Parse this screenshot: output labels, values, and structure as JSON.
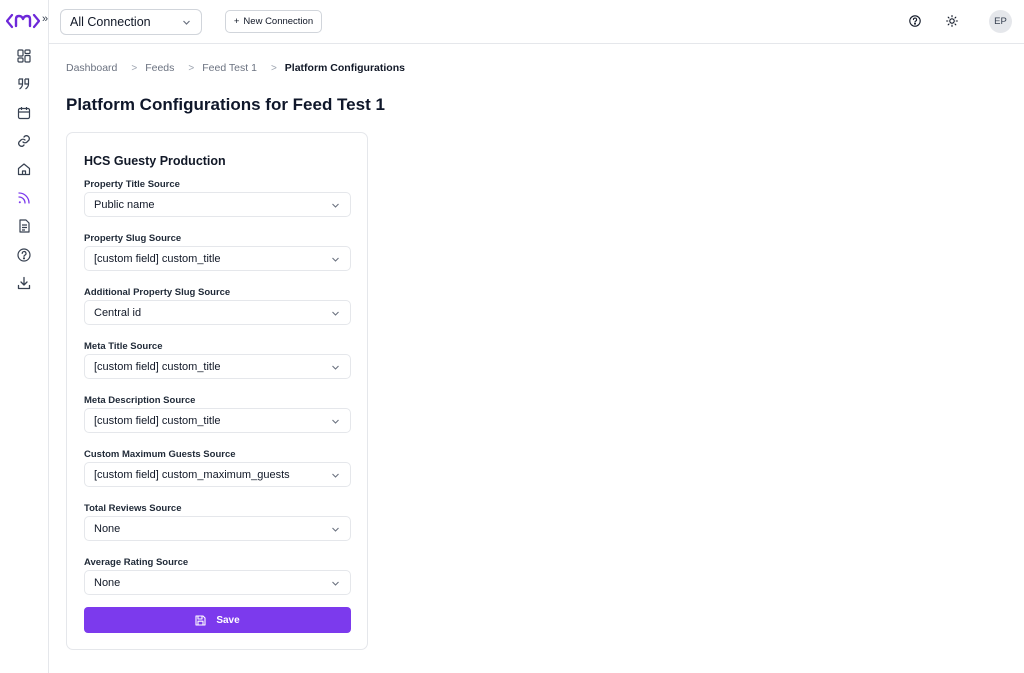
{
  "brand": {
    "accent": "#7c3aed",
    "logo_color": "#6d28d9"
  },
  "sidebar": {
    "items": [
      {
        "icon": "dashboard-icon"
      },
      {
        "icon": "quote-icon"
      },
      {
        "icon": "calendar-icon"
      },
      {
        "icon": "link-icon"
      },
      {
        "icon": "home-icon"
      },
      {
        "icon": "rss-icon",
        "active": true
      },
      {
        "icon": "document-icon"
      },
      {
        "icon": "help-circle-icon"
      },
      {
        "icon": "download-icon"
      }
    ]
  },
  "topbar": {
    "connection_select": "All Connection",
    "new_connection_label": "New Connection",
    "avatar_initials": "EP"
  },
  "breadcrumb": [
    "Dashboard",
    "Feeds",
    "Feed Test 1",
    "Platform Configurations"
  ],
  "page_title": "Platform Configurations for Feed Test 1",
  "card": {
    "title": "HCS Guesty Production",
    "fields": [
      {
        "label": "Property Title Source",
        "value": "Public name"
      },
      {
        "label": "Property Slug Source",
        "value": "[custom field] custom_title"
      },
      {
        "label": "Additional Property Slug Source",
        "value": "Central id"
      },
      {
        "label": "Meta Title Source",
        "value": "[custom field] custom_title"
      },
      {
        "label": "Meta Description Source",
        "value": "[custom field] custom_title"
      },
      {
        "label": "Custom Maximum Guests Source",
        "value": "[custom field] custom_maximum_guests"
      },
      {
        "label": "Total Reviews Source",
        "value": "None"
      },
      {
        "label": "Average Rating Source",
        "value": "None"
      }
    ],
    "save_label": "Save"
  }
}
